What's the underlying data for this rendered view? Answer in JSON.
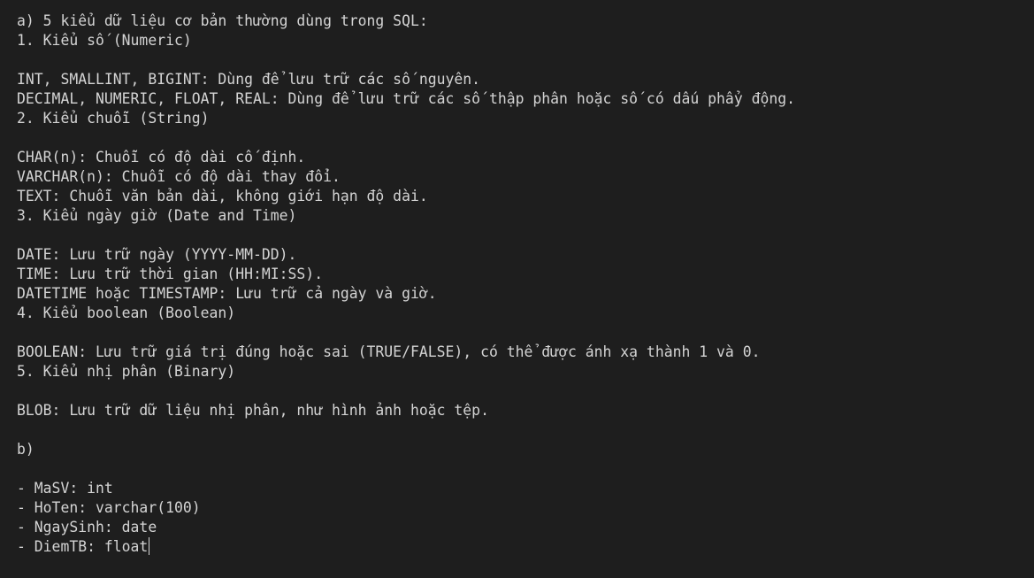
{
  "editor": {
    "lines": [
      "a) 5 kiểu dữ liệu cơ bản thường dùng trong SQL:",
      "1. Kiểu số (Numeric)",
      "",
      "INT, SMALLINT, BIGINT: Dùng để lưu trữ các số nguyên.",
      "DECIMAL, NUMERIC, FLOAT, REAL: Dùng để lưu trữ các số thập phân hoặc số có dấu phẩy động.",
      "2. Kiểu chuỗi (String)",
      "",
      "CHAR(n): Chuỗi có độ dài cố định.",
      "VARCHAR(n): Chuỗi có độ dài thay đổi.",
      "TEXT: Chuỗi văn bản dài, không giới hạn độ dài.",
      "3. Kiểu ngày giờ (Date and Time)",
      "",
      "DATE: Lưu trữ ngày (YYYY-MM-DD).",
      "TIME: Lưu trữ thời gian (HH:MI:SS).",
      "DATETIME hoặc TIMESTAMP: Lưu trữ cả ngày và giờ.",
      "4. Kiểu boolean (Boolean)",
      "",
      "BOOLEAN: Lưu trữ giá trị đúng hoặc sai (TRUE/FALSE), có thể được ánh xạ thành 1 và 0.",
      "5. Kiểu nhị phân (Binary)",
      "",
      "BLOB: Lưu trữ dữ liệu nhị phân, như hình ảnh hoặc tệp.",
      "",
      "b)",
      "",
      "- MaSV: int",
      "- HoTen: varchar(100)",
      "- NgaySinh: date",
      "- DiemTB: float"
    ]
  }
}
